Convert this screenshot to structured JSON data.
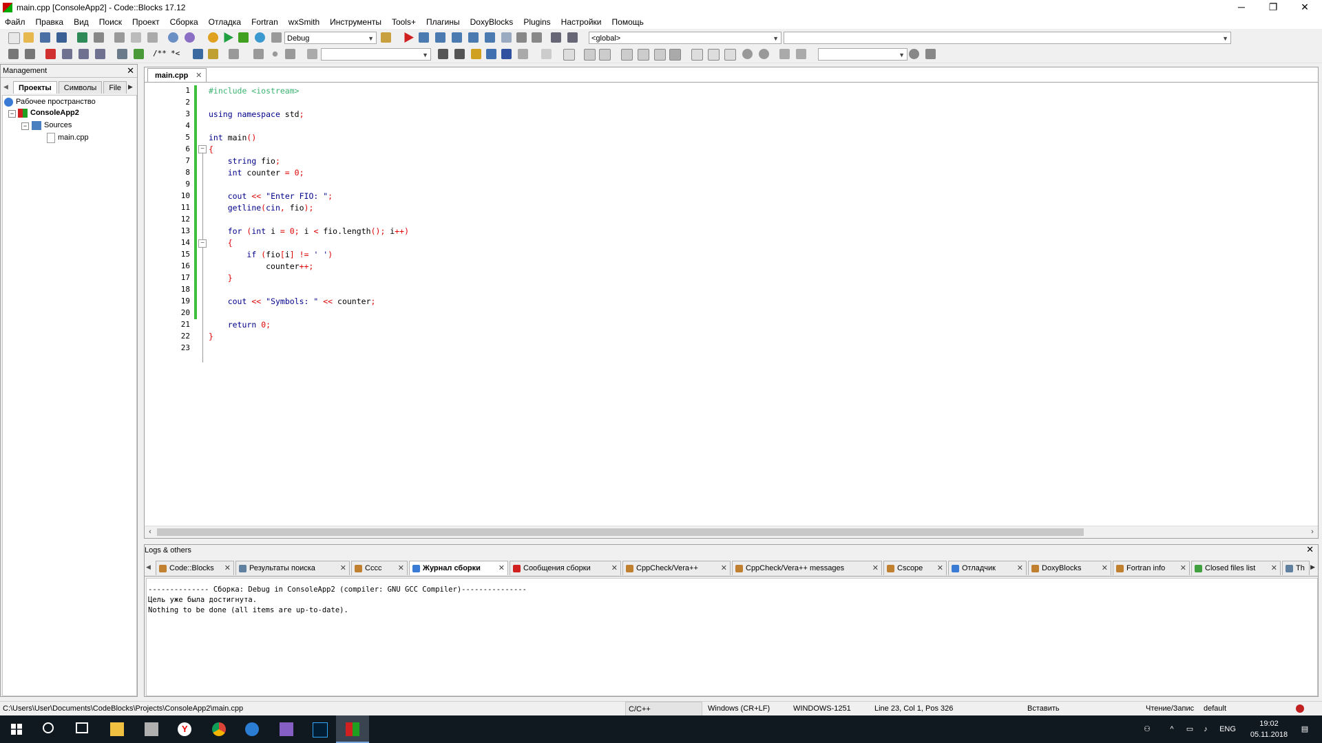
{
  "window": {
    "title": "main.cpp [ConsoleApp2] - Code::Blocks 17.12",
    "min_glyph": "─",
    "max_glyph": "❐",
    "close_glyph": "✕"
  },
  "menu": [
    "Файл",
    "Правка",
    "Вид",
    "Поиск",
    "Проект",
    "Сборка",
    "Отладка",
    "Fortran",
    "wxSmith",
    "Инструменты",
    "Tools+",
    "Плагины",
    "DoxyBlocks",
    "Plugins",
    "Настройки",
    "Помощь"
  ],
  "toolbar": {
    "build_target": "Debug",
    "scope": "<global>",
    "search_text": "",
    "symbol_text": "",
    "comment_open": "/**",
    "comment_close": "*<"
  },
  "management": {
    "title": "Management",
    "tabs": [
      "Проекты",
      "Символы",
      "File"
    ],
    "tree": {
      "workspace": "Рабочее пространство",
      "project": "ConsoleApp2",
      "folder": "Sources",
      "file": "main.cpp"
    }
  },
  "editor": {
    "tab": "main.cpp",
    "line_numbers": [
      "1",
      "2",
      "3",
      "4",
      "5",
      "6",
      "7",
      "8",
      "9",
      "10",
      "11",
      "12",
      "13",
      "14",
      "15",
      "16",
      "17",
      "18",
      "19",
      "20",
      "21",
      "22",
      "23"
    ],
    "code": [
      "#include <iostream>",
      "",
      "using namespace std;",
      "",
      "int main()",
      "{",
      "    string fio;",
      "    int counter = 0;",
      "",
      "    cout << \"Enter FIO: \";",
      "    getline(cin, fio);",
      "",
      "    for (int i = 0; i < fio.length(); i++)",
      "    {",
      "        if (fio[i] != ' ')",
      "            counter++;",
      "    }",
      "",
      "    cout << \"Symbols: \" << counter;",
      "",
      "    return 0;",
      "}",
      ""
    ]
  },
  "logs": {
    "title": "Logs & others",
    "tabs": [
      "Code::Blocks",
      "Результаты поиска",
      "Cccc",
      "Журнал сборки",
      "Сообщения сборки",
      "CppCheck/Vera++",
      "CppCheck/Vera++ messages",
      "Cscope",
      "Отладчик",
      "DoxyBlocks",
      "Fortran info",
      "Closed files list",
      "Th"
    ],
    "active_tab": "Журнал сборки",
    "lines": [
      "-------------- Сборка: Debug in ConsoleApp2 (compiler: GNU GCC Compiler)---------------",
      "Цель уже была достигнута.",
      "Nothing to be done (all items are up-to-date)."
    ]
  },
  "status": {
    "path": "C:\\Users\\User\\Documents\\CodeBlocks\\Projects\\ConsoleApp2\\main.cpp",
    "language": "C/C++",
    "eol": "Windows (CR+LF)",
    "encoding": "WINDOWS-1251",
    "position": "Line 23, Col 1, Pos 326",
    "insert_mode": "Вставить",
    "rw_mode": "Чтение/Запис",
    "profile": "default"
  },
  "taskbar": {
    "lang": "ENG",
    "time": "19:02",
    "date": "05.11.2018",
    "icons": [
      "windows-start-icon",
      "search-icon",
      "task-view-icon",
      "file-explorer-icon",
      "printer-icon",
      "yandex-browser-icon",
      "chrome-icon",
      "edge-icon",
      "visual-studio-icon",
      "photoshop-icon",
      "codeblocks-icon"
    ]
  },
  "colors": {
    "keyword": "#00008b",
    "preprocessor": "#3cb371",
    "operator": "#e00000",
    "change_bar": "#3dc13d"
  }
}
